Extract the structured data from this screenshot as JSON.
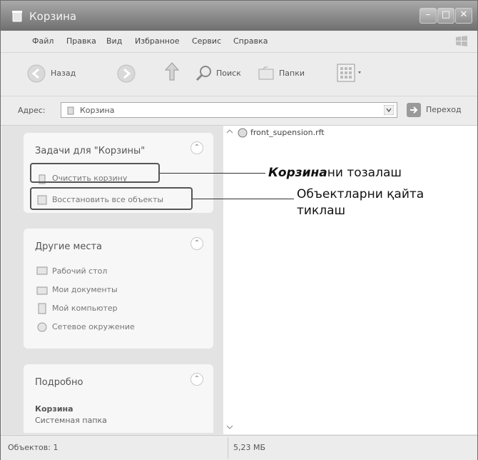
{
  "window": {
    "title": "Корзина"
  },
  "menu": [
    "Файл",
    "Правка",
    "Вид",
    "Избранное",
    "Сервис",
    "Справка"
  ],
  "toolbar": {
    "back": "Назад",
    "search": "Поиск",
    "folders": "Папки"
  },
  "address": {
    "label": "Адрес:",
    "value": "Корзина",
    "go": "Переход"
  },
  "tasks_panel": {
    "title": "Задачи для \"Корзины\"",
    "items": [
      "Очистить корзину",
      "Восстановить все объекты"
    ]
  },
  "places_panel": {
    "title": "Другие места",
    "items": [
      "Рабочий стол",
      "Мои документы",
      "Мой компьютер",
      "Сетевое окружение"
    ]
  },
  "details_panel": {
    "title": "Подробно",
    "name": "Корзина",
    "subtitle": "Системная папка"
  },
  "files": [
    {
      "name": "front_supension.rft"
    }
  ],
  "status": {
    "objects": "Объектов: 1",
    "size": "5,23 МБ"
  },
  "annotations": {
    "empty_bold": "Корзина",
    "empty_rest": "ни тозалаш",
    "restore_line1": "Объектларни қайта",
    "restore_line2": "тиклаш"
  }
}
